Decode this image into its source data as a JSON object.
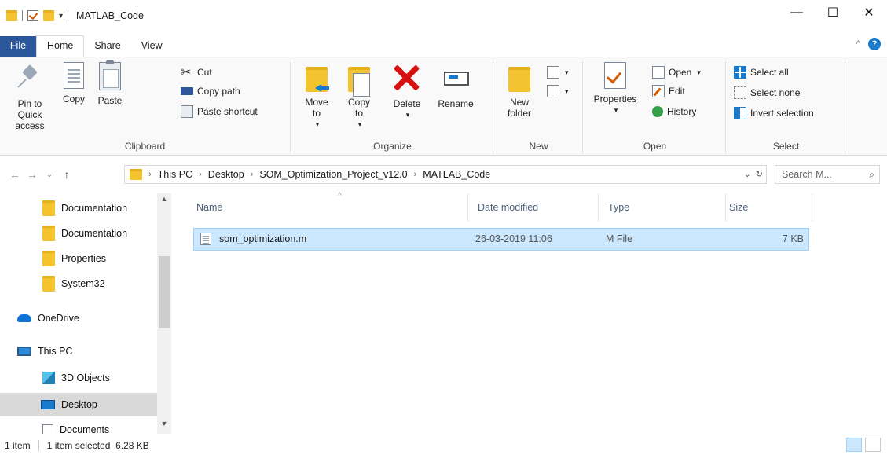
{
  "window": {
    "title": "MATLAB_Code",
    "controls": {
      "minimize": "—",
      "maximize": "☐",
      "close": "✕"
    }
  },
  "tabs": [
    {
      "label": "File"
    },
    {
      "label": "Home"
    },
    {
      "label": "Share"
    },
    {
      "label": "View"
    }
  ],
  "ribbon": {
    "clipboard": {
      "label": "Clipboard",
      "pin": "Pin to Quick access",
      "copy": "Copy",
      "paste": "Paste",
      "cut": "Cut",
      "copy_path": "Copy path",
      "paste_shortcut": "Paste shortcut"
    },
    "organize": {
      "label": "Organize",
      "move_to": "Move to",
      "copy_to": "Copy to",
      "delete": "Delete",
      "rename": "Rename"
    },
    "new": {
      "label": "New",
      "new_folder": "New folder"
    },
    "open": {
      "label": "Open",
      "properties": "Properties",
      "open": "Open",
      "edit": "Edit",
      "history": "History"
    },
    "select": {
      "label": "Select",
      "select_all": "Select all",
      "select_none": "Select none",
      "invert_selection": "Invert selection"
    }
  },
  "address": {
    "crumbs": [
      "This PC",
      "Desktop",
      "SOM_Optimization_Project_v12.0",
      "MATLAB_Code"
    ],
    "search_placeholder": "Search M..."
  },
  "nav": [
    {
      "label": "Documentation",
      "icon": "folder-icon"
    },
    {
      "label": "Documentation",
      "icon": "folder-icon"
    },
    {
      "label": "Properties",
      "icon": "folder-icon"
    },
    {
      "label": "System32",
      "icon": "folder-icon"
    },
    {
      "label": "OneDrive",
      "icon": "cloud-icon"
    },
    {
      "label": "This PC",
      "icon": "computer-icon"
    },
    {
      "label": "3D Objects",
      "icon": "cube-icon"
    },
    {
      "label": "Desktop",
      "icon": "desktop-icon"
    },
    {
      "label": "Documents",
      "icon": "documents-icon"
    }
  ],
  "columns": {
    "name": "Name",
    "date": "Date modified",
    "type": "Type",
    "size": "Size"
  },
  "files": [
    {
      "name": "som_optimization.m",
      "date": "26-03-2019 11:06",
      "type": "M File",
      "size": "7 KB"
    }
  ],
  "status": {
    "count": "1 item",
    "selected": "1 item selected  6.28 KB"
  },
  "colors": {
    "accent": "#1979ca",
    "selection": "#cce8ff",
    "folder": "#f4c430",
    "delete_red": "#d70f0f"
  }
}
